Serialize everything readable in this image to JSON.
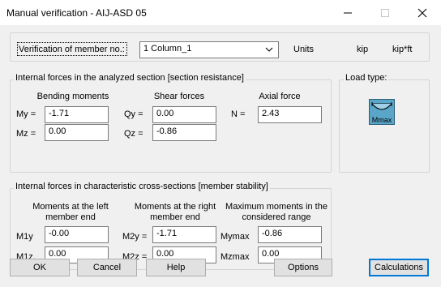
{
  "window": {
    "title": "Manual verification - AIJ-ASD 05"
  },
  "member": {
    "label": "Verification of member no.:",
    "selected": "1 Column_1",
    "units_label": "Units",
    "unit_force": "kip",
    "unit_moment": "kip*ft"
  },
  "section": {
    "title": "Internal forces in the analyzed section [section resistance]",
    "bending_header": "Bending moments",
    "shear_header": "Shear forces",
    "axial_header": "Axial force",
    "my_label": "My =",
    "my_value": "-1.71",
    "mz_label": "Mz =",
    "mz_value": "0.00",
    "qy_label": "Qy =",
    "qy_value": "0.00",
    "qz_label": "Qz =",
    "qz_value": "-0.86",
    "n_label": "N =",
    "n_value": "2.43"
  },
  "load_type": {
    "title": "Load type:",
    "icon_caption": "Mmax"
  },
  "stability": {
    "title": "Internal forces in characteristic cross-sections [member stability]",
    "left_header_1": "Moments at the left",
    "left_header_2": "member end",
    "right_header_1": "Moments at the right",
    "right_header_2": "member end",
    "max_header_1": "Maximum moments in the",
    "max_header_2": "considered range",
    "m1y_label": "M1y",
    "m1y_value": "-0.00",
    "m1z_label": "M1z.",
    "m1z_value": "0.00",
    "m2y_label": "M2y =",
    "m2y_value": "-1.71",
    "m2z_label": "M2z =",
    "m2z_value": "0.00",
    "mymax_label": "Mymax",
    "mymax_value": "-0.86",
    "mzmax_label": "Mzmax",
    "mzmax_value": "0.00"
  },
  "buttons": {
    "ok": "OK",
    "cancel": "Cancel",
    "help": "Help",
    "options": "Options",
    "calculations": "Calculations"
  }
}
